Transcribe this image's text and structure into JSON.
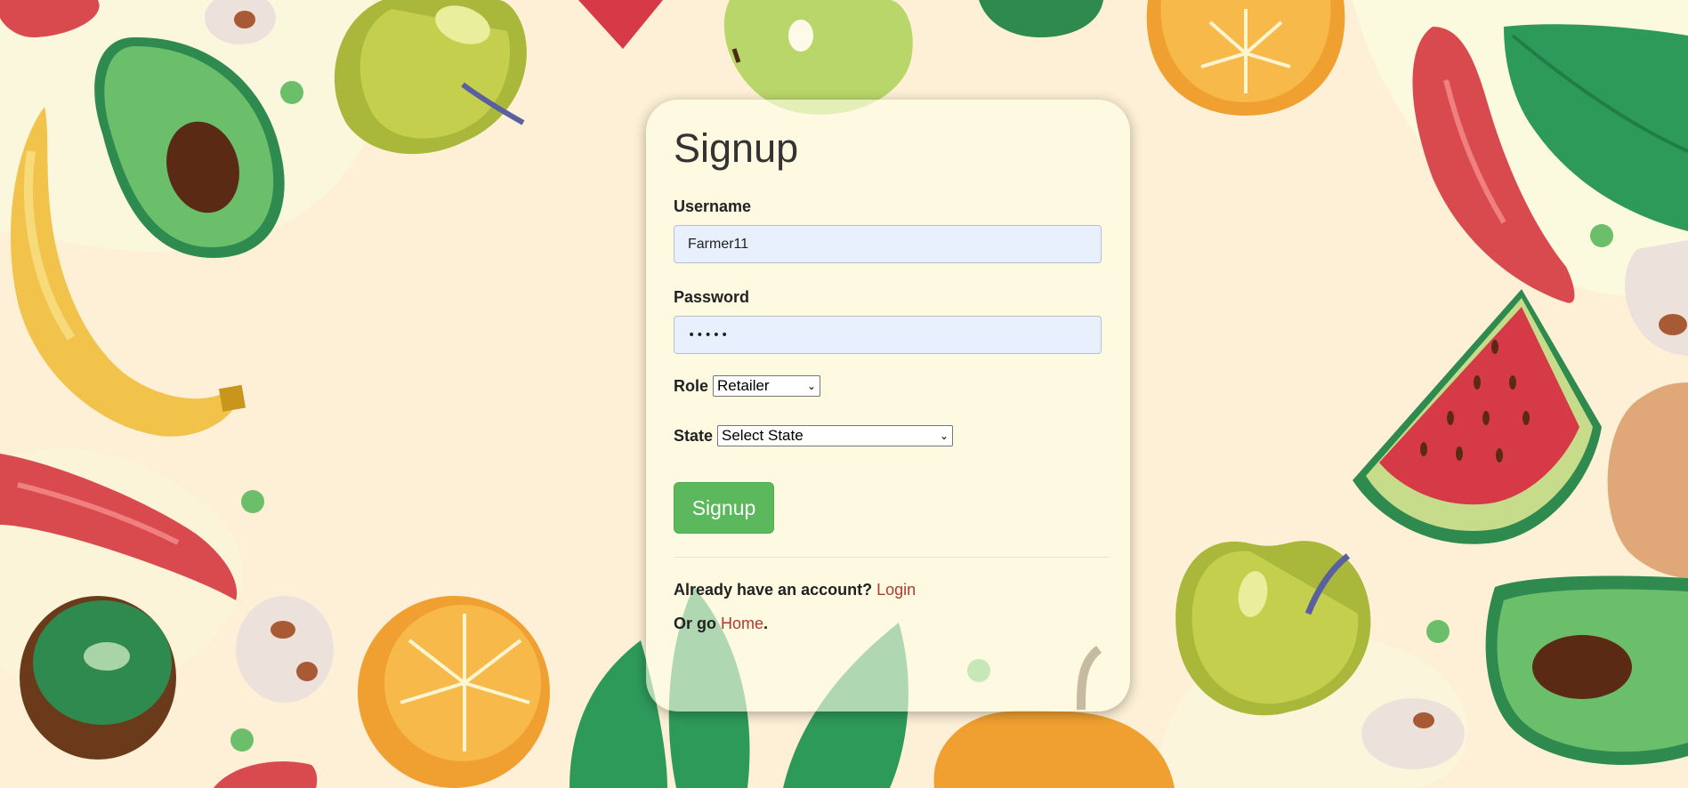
{
  "form": {
    "title": "Signup",
    "username_label": "Username",
    "username_value": "Farmer11",
    "password_label": "Password",
    "password_masked": "•••••",
    "role_label": "Role",
    "role_selected": "Retailer",
    "state_label": "State",
    "state_selected": "Select State",
    "submit_label": "Signup"
  },
  "footer": {
    "account_prompt": "Already have an account?",
    "login_link": "Login",
    "or_go": "Or go",
    "home_link": "Home",
    "period": "."
  },
  "colors": {
    "background": "#fdf0d6",
    "button": "#5cb85c",
    "link": "#b03a2e",
    "input_fill": "#e8f0fe"
  },
  "background_icons": [
    "avocado-icon",
    "apple-icon",
    "banana-icon",
    "orange-icon",
    "chili-icon",
    "watermelon-icon",
    "kiwi-icon",
    "mushroom-icon",
    "leaf-icon",
    "pumpkin-icon",
    "potato-icon",
    "pea-icon"
  ]
}
